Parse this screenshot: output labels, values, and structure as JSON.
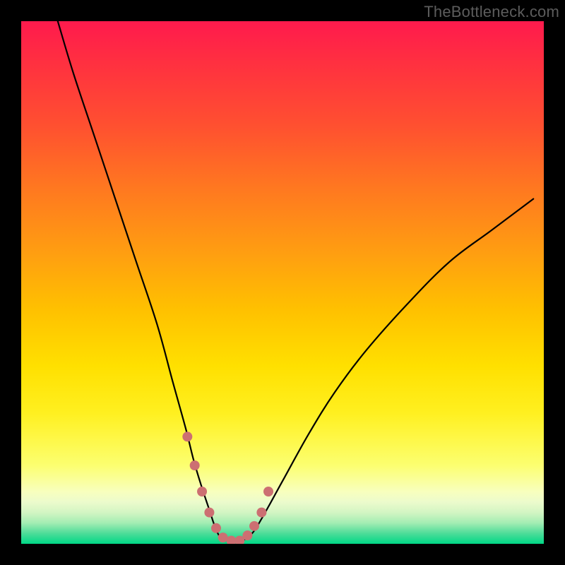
{
  "watermark": "TheBottleneck.com",
  "colors": {
    "page_bg": "#000000",
    "curve_stroke": "#000000",
    "marker_fill": "#cc6f72",
    "gradient_top": "#ff1a4d",
    "gradient_bottom": "#00d886"
  },
  "chart_data": {
    "type": "line",
    "title": "",
    "xlabel": "",
    "ylabel": "",
    "xlim": [
      0,
      100
    ],
    "ylim": [
      0,
      100
    ],
    "note": "Axes are unlabeled; x and y are normalized 0–100 based on the plot area. y=0 is the bottom (green) edge.",
    "series": [
      {
        "name": "bottleneck-curve",
        "x": [
          7,
          10,
          14,
          18,
          22,
          26,
          29,
          31.5,
          33,
          34.5,
          36,
          37,
          38,
          39.5,
          42,
          44,
          46,
          50,
          55,
          60,
          66,
          74,
          82,
          90,
          98
        ],
        "y": [
          100,
          90,
          78,
          66,
          54,
          42,
          31,
          22,
          16,
          11,
          6.5,
          3.5,
          1.4,
          0.6,
          0.6,
          1.8,
          4.8,
          12,
          21,
          29,
          37,
          46,
          54,
          60,
          66
        ]
      }
    ],
    "markers": {
      "name": "highlighted-points",
      "x": [
        31.8,
        33.2,
        34.6,
        36.0,
        37.3,
        38.6,
        40.2,
        41.8,
        43.3,
        44.6,
        46.0,
        47.3
      ],
      "y": [
        20.5,
        15.0,
        10.0,
        6.0,
        3.0,
        1.2,
        0.6,
        0.6,
        1.6,
        3.4,
        6.0,
        10.0
      ],
      "radius_px": 7
    }
  }
}
